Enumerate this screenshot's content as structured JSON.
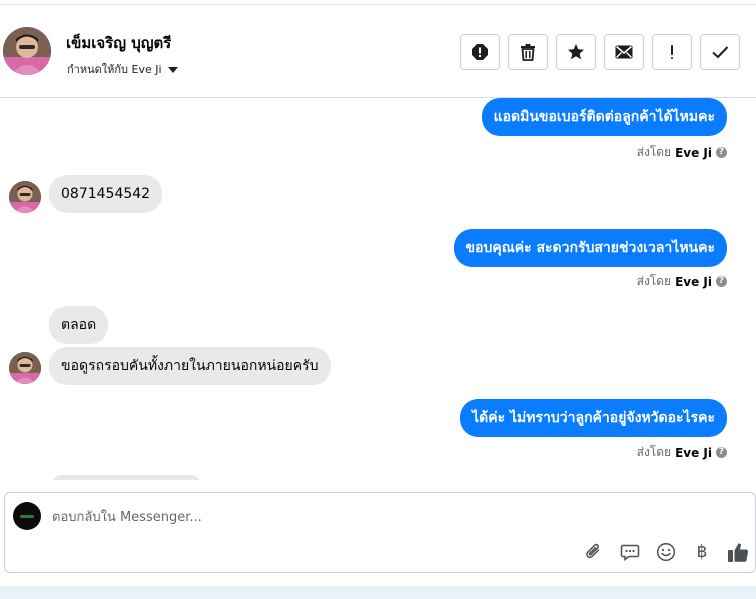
{
  "header": {
    "contact_name": "เข็มเจริญ บุญตรี",
    "assign_label": "กำหนดให้กับ Eve Ji",
    "actions": [
      {
        "icon": "spam-icon",
        "label": "Mark as spam"
      },
      {
        "icon": "trash-icon",
        "label": "Delete"
      },
      {
        "icon": "star-icon",
        "label": "Follow up"
      },
      {
        "icon": "envelope-icon",
        "label": "Mark as unread"
      },
      {
        "icon": "exclamation-icon",
        "label": "Important"
      },
      {
        "icon": "check-icon",
        "label": "Done"
      }
    ]
  },
  "thread": {
    "messages": [
      {
        "direction": "outgoing",
        "text": "แอดมินขอเบอร์ติดต่อลูกค้าได้ไหมคะ",
        "sent_by_prefix": "ส่งโดย",
        "sent_by_name": "Eve Ji"
      },
      {
        "direction": "incoming",
        "text": "0871454542"
      },
      {
        "direction": "outgoing",
        "text": "ขอบคุณค่ะ สะดวกรับสายช่วงเวลาไหนคะ",
        "sent_by_prefix": "ส่งโดย",
        "sent_by_name": "Eve Ji"
      },
      {
        "direction": "incoming",
        "text": "ตลอด"
      },
      {
        "direction": "incoming",
        "text": "ขอดูรถรอบคันทั้งภายในภายนอกหน่อยครับ"
      },
      {
        "direction": "outgoing",
        "text": "ได้ค่ะ ไม่ทราบว่าลูกค้าอยู่จังหวัดอะไรคะ",
        "sent_by_prefix": "ส่งโดย",
        "sent_by_name": "Eve Ji"
      }
    ],
    "help_glyph": "?"
  },
  "composer": {
    "placeholder": "ตอบกลับใน Messenger...",
    "value": "",
    "tools": [
      "paperclip-icon",
      "saved-reply-icon",
      "emoji-icon",
      "payment-icon",
      "like-icon"
    ],
    "currency_glyph": "฿"
  },
  "colors": {
    "outgoing_bubble": "#0a7cff",
    "incoming_bubble": "#e9e9eb",
    "muted_text": "#65676b"
  }
}
